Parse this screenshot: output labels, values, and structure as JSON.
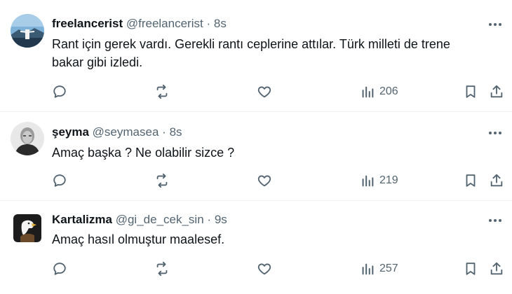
{
  "tweets": [
    {
      "name": "freelancerist",
      "handle": "@freelancerist",
      "time": "8s",
      "text_line1": "Rant için gerek vardı. Gerekli rantı ceplerine attılar. Türk milleti de trene",
      "text_line2": "bakar gibi izledi.",
      "views": "206",
      "avatar_icon": "avatar-landscape-icon"
    },
    {
      "name": "şeyma",
      "handle": "@seymasea",
      "time": "8s",
      "text_line1": "Amaç başka ? Ne olabilir sizce ?",
      "views": "219",
      "avatar_icon": "avatar-portrait-icon"
    },
    {
      "name": "Kartalizma",
      "handle": "@gi_de_cek_sin",
      "time": "9s",
      "text_line1": "Amaç hasıl olmuştur maalesef.",
      "views": "257",
      "avatar_icon": "avatar-eagle-icon"
    }
  ],
  "separator": "·",
  "colors": {
    "text": "#0f1419",
    "muted": "#536471",
    "divider": "#eff3f4"
  }
}
